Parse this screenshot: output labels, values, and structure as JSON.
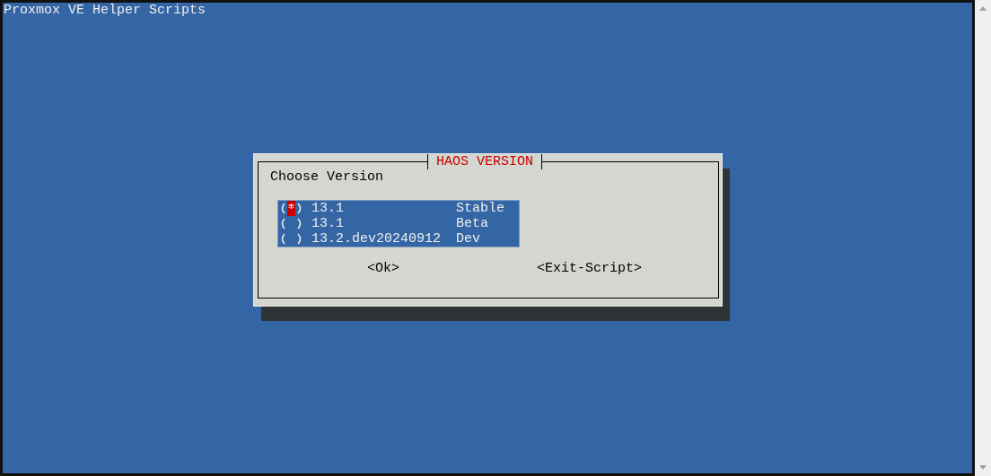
{
  "screen_title": "Proxmox VE Helper Scripts",
  "dialog": {
    "title": "HAOS VERSION",
    "prompt": "Choose Version",
    "options": [
      {
        "version": "13.1",
        "channel": "Stable",
        "selected": true
      },
      {
        "version": "13.1",
        "channel": "Beta",
        "selected": false
      },
      {
        "version": "13.2.dev20240912",
        "channel": "Dev",
        "selected": false
      }
    ],
    "buttons": [
      "<Ok>",
      "<Exit-Script>"
    ]
  }
}
